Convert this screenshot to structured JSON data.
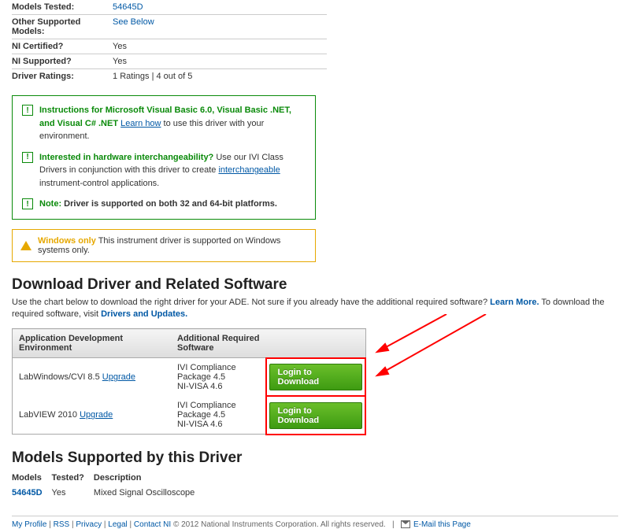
{
  "info": {
    "models_tested_label": "Models Tested:",
    "models_tested_value": "54645D",
    "other_models_label": "Other Supported Models:",
    "other_models_value": "See Below",
    "certified_label": "NI Certified?",
    "certified_value": "Yes",
    "supported_label": "NI Supported?",
    "supported_value": "Yes",
    "ratings_label": "Driver Ratings:",
    "ratings_value": "1 Ratings | 4 out of 5"
  },
  "notice": {
    "row1_bold": "Instructions for Microsoft Visual Basic 6.0, Visual Basic .NET, and Visual C# .NET",
    "row1_link": "Learn how",
    "row1_tail": " to use this driver with your environment.",
    "row2_bold": "Interested in hardware interchangeability?",
    "row2_mid": " Use our IVI Class Drivers in conjunction with this driver to create ",
    "row2_link": "interchangeable",
    "row2_tail": " instrument-control applications.",
    "row3_note": "Note:",
    "row3_bold": "  Driver is supported on both 32 and 64-bit platforms."
  },
  "warn": {
    "bold": "Windows only",
    "text": " This instrument driver is supported on Windows systems only."
  },
  "download": {
    "heading": "Download Driver and Related Software",
    "blurb_a": "Use the chart below to download the right driver for your ADE. Not sure if you already have the additional required software? ",
    "learn_more": "Learn More.",
    "blurb_b": " To download the required software, visit  ",
    "drivers_link": "Drivers and Updates.",
    "th1": "Application Development Environment",
    "th2": "Additional Required Software",
    "rows": [
      {
        "ade": "LabWindows/CVI 8.5 ",
        "upg": "Upgrade",
        "req1": "IVI Compliance Package 4.5",
        "req2": "NI-VISA 4.6",
        "btn": "Login to Download"
      },
      {
        "ade": "LabVIEW 2010 ",
        "upg": "Upgrade",
        "req1": "IVI Compliance Package 4.5",
        "req2": "NI-VISA 4.6",
        "btn": "Login to Download"
      }
    ]
  },
  "models": {
    "heading": "Models Supported by this Driver",
    "th1": "Models",
    "th2": "Tested?",
    "th3": "Description",
    "row": {
      "model": "54645D",
      "tested": "Yes",
      "desc": "Mixed Signal Oscilloscope"
    }
  },
  "footer": {
    "my_profile": "My Profile",
    "rss": "RSS",
    "privacy": "Privacy",
    "legal": "Legal",
    "contact": "Contact NI",
    "copy": " © 2012 National Instruments Corporation. All rights reserved.",
    "email": "E-Mail this Page"
  }
}
